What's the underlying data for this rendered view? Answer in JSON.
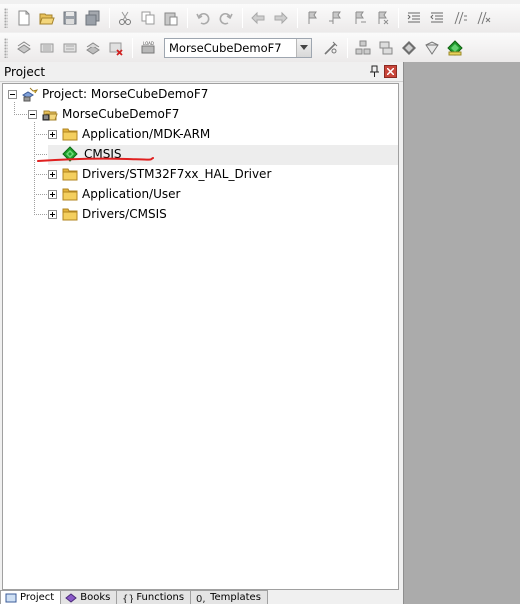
{
  "toolbar1": {
    "icons": [
      "new-file-icon",
      "open-folder-icon",
      "save-icon",
      "save-all-icon",
      "cut-icon",
      "copy-icon",
      "paste-icon",
      "undo-icon",
      "redo-icon",
      "nav-back-icon",
      "nav-forward-icon",
      "bookmark-icon",
      "bookmark-prev-icon",
      "bookmark-next-icon",
      "bookmark-clear-icon",
      "indent-icon",
      "unindent-icon",
      "comment-icon",
      "uncomment-icon"
    ]
  },
  "toolbar2": {
    "target": "MorseCubeDemoF7",
    "icons": [
      "translate-icon",
      "build-icon",
      "rebuild-icon",
      "batch-build-icon",
      "stop-build-icon",
      "download-icon",
      "target-options-icon",
      "manage-components-icon",
      "file-extensions-icon",
      "select-packs-icon",
      "pack-installer-icon"
    ]
  },
  "panel": {
    "title": "Project"
  },
  "tree": {
    "root": "Project: MorseCubeDemoF7",
    "target": "MorseCubeDemoF7",
    "items": [
      {
        "label": "Application/MDK-ARM",
        "type": "folder"
      },
      {
        "label": "CMSIS",
        "type": "component"
      },
      {
        "label": "Drivers/STM32F7xx_HAL_Driver",
        "type": "folder"
      },
      {
        "label": "Application/User",
        "type": "folder"
      },
      {
        "label": "Drivers/CMSIS",
        "type": "folder"
      }
    ]
  },
  "tabs": [
    {
      "label": "Project",
      "icon": "project-tab-icon"
    },
    {
      "label": "Books",
      "icon": "books-tab-icon"
    },
    {
      "label": "Functions",
      "icon": "functions-tab-icon"
    },
    {
      "label": "Templates",
      "icon": "templates-tab-icon"
    }
  ],
  "colors": {
    "annotation": "#e02020",
    "folder": "#f0c44c",
    "component": "#2ca02c"
  }
}
